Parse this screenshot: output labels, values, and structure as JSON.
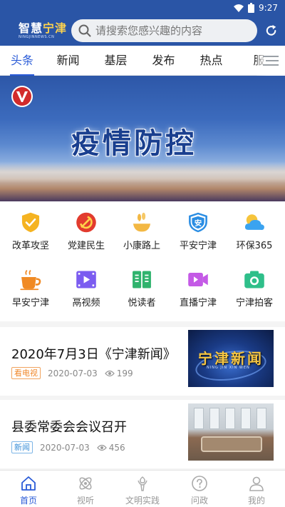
{
  "status_bar": {
    "time": "9:27"
  },
  "header": {
    "logo_text_a": "智慧",
    "logo_text_b": "宁津",
    "logo_sub": "NINGJINNEWS.CN",
    "search_placeholder": "请搜索您感兴趣的内容"
  },
  "tabs": [
    {
      "label": "头条",
      "active": true
    },
    {
      "label": "新闻"
    },
    {
      "label": "基层"
    },
    {
      "label": "发布"
    },
    {
      "label": "热点"
    },
    {
      "label": "服"
    }
  ],
  "banner": {
    "title": "疫情防控"
  },
  "grid": [
    {
      "label": "改革攻坚",
      "icon": "shield-check-icon",
      "color": "#f5b321"
    },
    {
      "label": "党建民生",
      "icon": "party-emblem-icon",
      "color": "#e23b2e"
    },
    {
      "label": "小康路上",
      "icon": "wheat-bowl-icon",
      "color": "#f3b843"
    },
    {
      "label": "平安宁津",
      "icon": "safety-shield-icon",
      "color": "#2a8de3"
    },
    {
      "label": "环保365",
      "icon": "weather-icon",
      "color": "#3aa3f0"
    },
    {
      "label": "早安宁津",
      "icon": "coffee-cup-icon",
      "color": "#f08a24"
    },
    {
      "label": "鬲视频",
      "icon": "video-film-icon",
      "color": "#7b5cf0"
    },
    {
      "label": "悦读者",
      "icon": "book-icon",
      "color": "#2fb36d"
    },
    {
      "label": "直播宁津",
      "icon": "video-camera-icon",
      "color": "#c45ae6"
    },
    {
      "label": "宁津拍客",
      "icon": "camera-icon",
      "color": "#2fbf8a"
    }
  ],
  "news": [
    {
      "title": "2020年7月3日《宁津新闻》",
      "tag": "看电视",
      "date": "2020-07-03",
      "views": "199",
      "thumb_text": "宁津新闻",
      "thumb_sub": "NING JIN XIN WEN"
    },
    {
      "title": "县委常委会会议召开",
      "tag": "新闻",
      "date": "2020-07-03",
      "views": "456"
    }
  ],
  "bottom_nav": [
    {
      "label": "首页",
      "active": true
    },
    {
      "label": "视听"
    },
    {
      "label": "文明实践"
    },
    {
      "label": "问政"
    },
    {
      "label": "我的"
    }
  ],
  "colors": {
    "primary": "#2a55a6",
    "accent": "#2a5bd7"
  }
}
